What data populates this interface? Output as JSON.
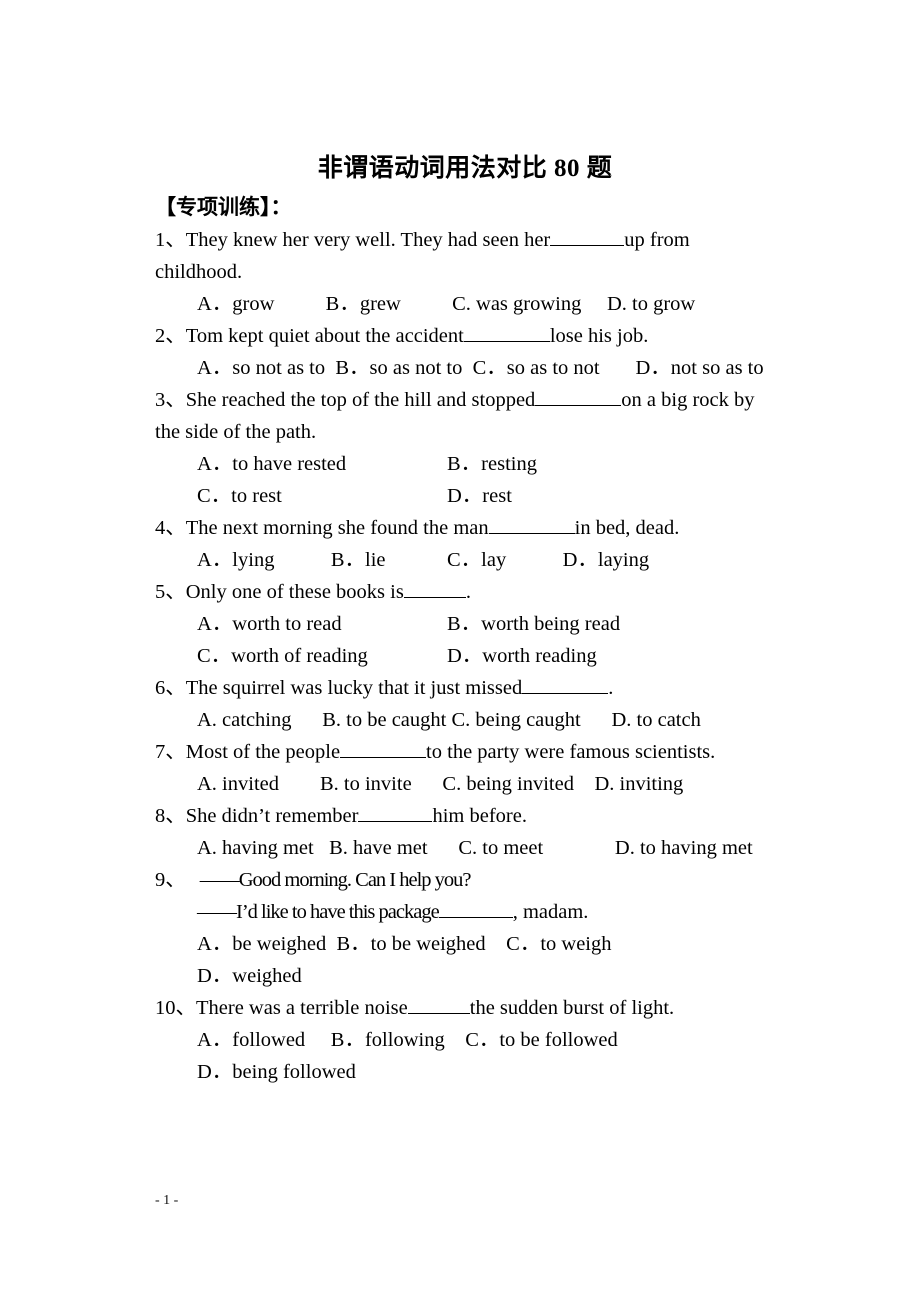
{
  "document": {
    "title": "非谓语动词用法对比 80 题",
    "section_heading": "【专项训练】：",
    "page_number": "- 1 -"
  },
  "questions": [
    {
      "number": "1、",
      "stem_before": "They knew her very well. They had seen her",
      "stem_after": "up from childhood.",
      "options_line1": "A．grow          B．grew          C. was growing     D. to grow",
      "options_line2": "",
      "layout": "single-row"
    },
    {
      "number": "2、",
      "stem_before": "Tom kept quiet about the accident",
      "stem_after": "lose his job.",
      "options_line1": "A．so not as to  B．so as not to  C．so as to not       D．not so as to",
      "options_line2": "",
      "layout": "wrap-row"
    },
    {
      "number": "3、",
      "stem_before": "She reached the top of the hill and stopped",
      "stem_after": "on a big rock by the side of the path.",
      "options_line1_a": "A．to have rested",
      "options_line1_b": "B．resting",
      "options_line2_a": "C．to rest",
      "options_line2_b": "D．rest",
      "layout": "two-column"
    },
    {
      "number": "4、",
      "stem_before": "The next morning she found the man",
      "stem_after": "in bed, dead.",
      "options_line1": "A．lying           B．lie            C．lay           D．laying",
      "options_line2": "",
      "layout": "single-row"
    },
    {
      "number": "5、",
      "stem_before": "Only one of these books is",
      "stem_after": ".",
      "options_line1_a": "A．worth to read",
      "options_line1_b": "B．worth being read",
      "options_line2_a": "C．worth of reading",
      "options_line2_b": "D．worth reading",
      "layout": "two-column"
    },
    {
      "number": "6、",
      "stem_before": "The squirrel was lucky that it just missed",
      "stem_after": ".",
      "options_line1": "A. catching      B. to be caught C. being caught      D. to catch",
      "options_line2": "",
      "layout": "single-row"
    },
    {
      "number": "7、",
      "stem_before": "Most of the people",
      "stem_after": "to the party were famous scientists.",
      "options_line1": "A. invited        B. to invite      C. being invited    D. inviting",
      "options_line2": "",
      "layout": "single-row"
    },
    {
      "number": "8、",
      "stem_before": "She didn’t remember",
      "stem_after": "him before.",
      "options_line1": "A. having met   B. have met      C. to meet              D. to having met",
      "options_line2": "",
      "layout": "wrap-row"
    },
    {
      "number": "9、",
      "dialog_line1": "——Good morning. Can I help you?",
      "dialog_line2_before": "——I’d like to have this package",
      "dialog_line2_after": ", madam.",
      "options_line1": "A．be weighed  B．to be weighed    C．to weigh",
      "options_line2": "D．weighed",
      "layout": "dialog"
    },
    {
      "number": "10、",
      "stem_before": "There was a terrible noise",
      "stem_after": "the sudden burst of light.",
      "options_line1": "A．followed     B．following    C．to be followed",
      "options_line2": "D．being followed",
      "layout": "two-line"
    }
  ]
}
